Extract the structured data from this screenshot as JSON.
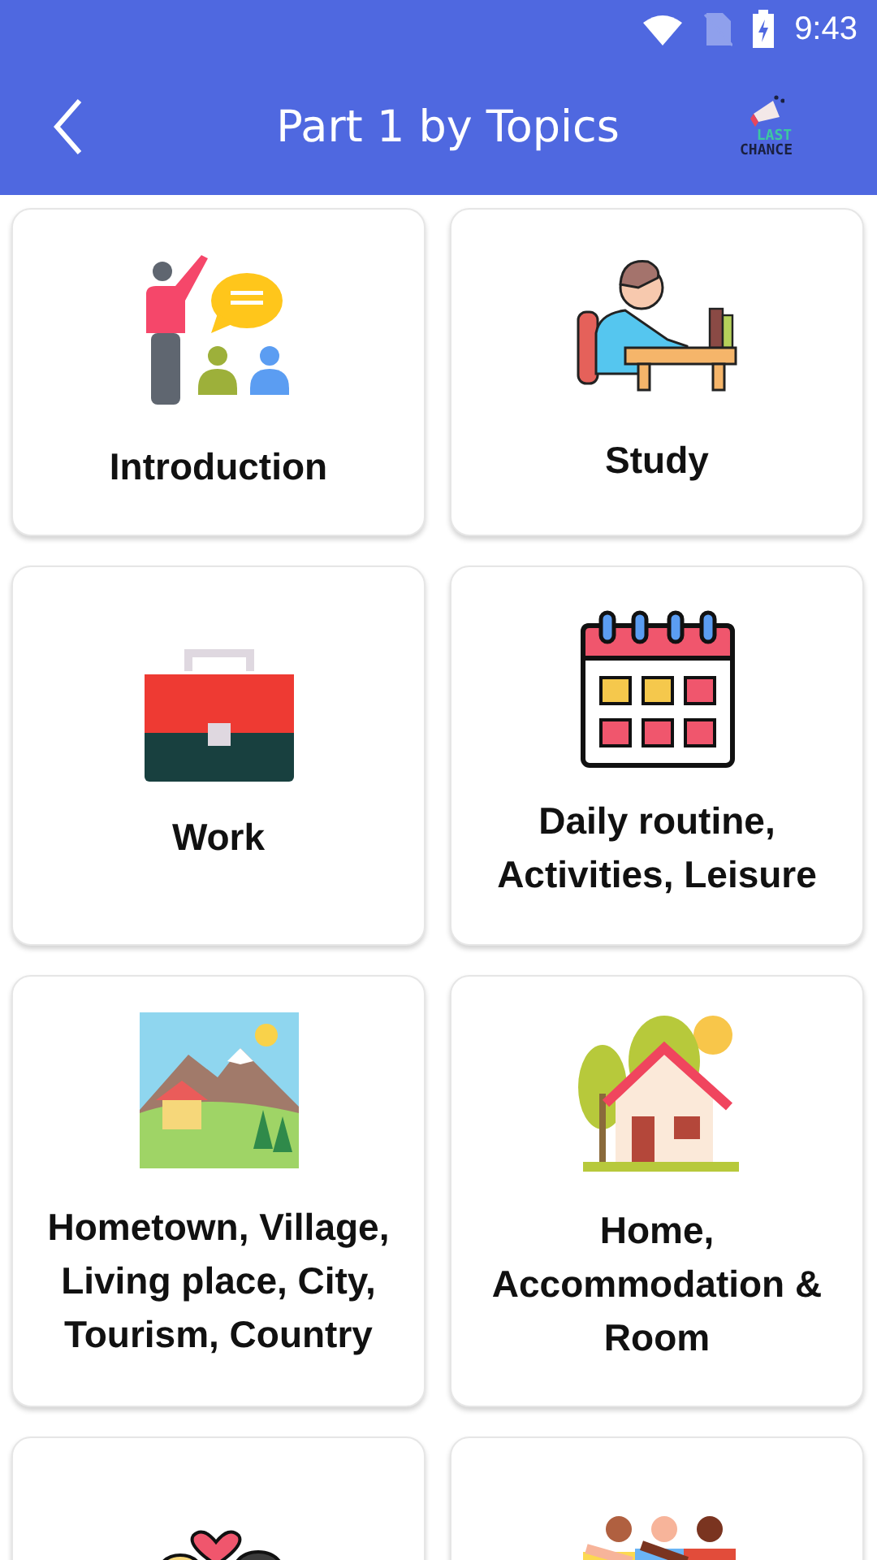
{
  "status_bar": {
    "time": "9:43"
  },
  "app_bar": {
    "title": "Part 1 by Topics",
    "logo": {
      "line_1": "LAST",
      "line_2": "CHANCE"
    }
  },
  "topics": [
    {
      "kind": "teaching",
      "lines": [
        "Introduction"
      ]
    },
    {
      "kind": "studying",
      "lines": [
        "Study"
      ]
    },
    {
      "kind": "briefcase",
      "lines": [
        "Work"
      ]
    },
    {
      "kind": "calendar",
      "lines": [
        "Daily routine,",
        "Activities, Leisure"
      ]
    },
    {
      "kind": "landscape",
      "lines": [
        "Hometown, Village,",
        "Living place, City,",
        "Tourism, Country"
      ]
    },
    {
      "kind": "house",
      "lines": [
        "Home,",
        "Accommodation &",
        "Room"
      ]
    },
    {
      "kind": "couple"
    },
    {
      "kind": "friends"
    }
  ]
}
